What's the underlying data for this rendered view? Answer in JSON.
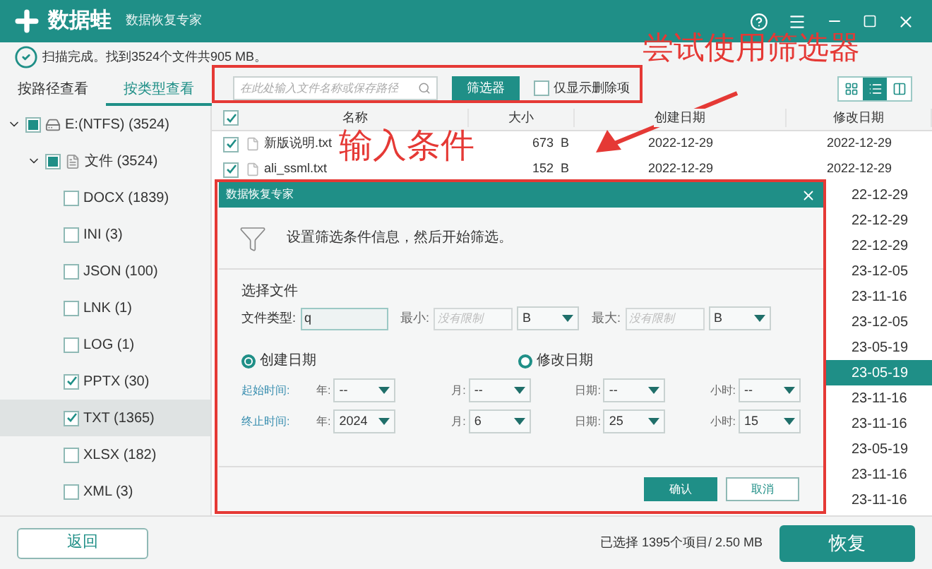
{
  "window": {
    "logo": "数据蛙",
    "subtitle": "数据恢复专家"
  },
  "status": "扫描完成。找到3524个文件共905 MB。",
  "view_tabs": [
    {
      "label": "按路径查看",
      "selected": false
    },
    {
      "label": "按类型查看",
      "selected": true
    }
  ],
  "search": {
    "placeholder": "在此处输入文件名称或保存路径"
  },
  "filter_button": "筛选器",
  "deleted_only": {
    "label": "仅显示删除项",
    "checked": false
  },
  "view_modes": [
    {
      "kind": "grid",
      "selected": false
    },
    {
      "kind": "list",
      "selected": true
    },
    {
      "kind": "columns",
      "selected": false
    }
  ],
  "tree": [
    {
      "label": "E:(NTFS) (3524)",
      "kind": "drive",
      "expanded": true,
      "checked": false,
      "partial": true,
      "children": [
        {
          "label": "文件 (3524)",
          "kind": "folder",
          "expanded": true,
          "checked": false,
          "partial": true,
          "children": [
            {
              "label": "DOCX (1839)",
              "checked": false,
              "selected": false
            },
            {
              "label": "INI (3)",
              "checked": false,
              "selected": false
            },
            {
              "label": "JSON (100)",
              "checked": false,
              "selected": false
            },
            {
              "label": "LNK (1)",
              "checked": false,
              "selected": false
            },
            {
              "label": "LOG (1)",
              "checked": false,
              "selected": false
            },
            {
              "label": "PPTX (30)",
              "checked": true,
              "selected": false
            },
            {
              "label": "TXT (1365)",
              "checked": true,
              "selected": true
            },
            {
              "label": "XLSX (182)",
              "checked": false,
              "selected": false
            },
            {
              "label": "XML (3)",
              "checked": false,
              "selected": false
            }
          ]
        }
      ]
    }
  ],
  "table": {
    "header_checked": true,
    "columns": [
      "名称",
      "大小",
      "创建日期",
      "修改日期"
    ],
    "rows": [
      {
        "checked": true,
        "name": "新版说明.txt",
        "size": "673  B",
        "created": "2022-12-29",
        "modified": "2022-12-29",
        "selected": false
      },
      {
        "checked": true,
        "name": "ali_ssml.txt",
        "size": "152  B",
        "created": "2022-12-29",
        "modified": "2022-12-29",
        "selected": false
      },
      {
        "modified": "22-12-29",
        "selected": false
      },
      {
        "modified": "22-12-29",
        "selected": false
      },
      {
        "modified": "22-12-29",
        "selected": false
      },
      {
        "modified": "23-12-05",
        "selected": false
      },
      {
        "modified": "23-11-16",
        "selected": false
      },
      {
        "modified": "23-12-05",
        "selected": false
      },
      {
        "modified": "23-05-19",
        "selected": false
      },
      {
        "modified": "23-05-19",
        "selected": true
      },
      {
        "modified": "23-11-16",
        "selected": false
      },
      {
        "modified": "23-11-16",
        "selected": false
      },
      {
        "modified": "23-05-19",
        "selected": false
      },
      {
        "modified": "23-11-16",
        "selected": false
      },
      {
        "modified": "23-11-16",
        "selected": false
      }
    ]
  },
  "footer": {
    "back": "返回",
    "selection": "已选择 1395个项目/ 2.50 MB",
    "recover": "恢复"
  },
  "dialog": {
    "title": "数据恢复专家",
    "message": "设置筛选条件信息，然后开始筛选。",
    "section": "选择文件",
    "file_type": {
      "label": "文件类型:",
      "value": "q"
    },
    "min": {
      "label": "最小:",
      "placeholder": "没有限制",
      "unit": "B"
    },
    "max": {
      "label": "最大:",
      "placeholder": "没有限制",
      "unit": "B"
    },
    "date_modes": [
      {
        "label": "创建日期",
        "selected": true
      },
      {
        "label": "修改日期",
        "selected": false
      }
    ],
    "ranges": [
      {
        "label": "起始时间:",
        "fields": [
          {
            "label": "年:",
            "value": "--"
          },
          {
            "label": "月:",
            "value": "--"
          },
          {
            "label": "日期:",
            "value": "--"
          },
          {
            "label": "小时:",
            "value": "--"
          }
        ]
      },
      {
        "label": "终止时间:",
        "fields": [
          {
            "label": "年:",
            "value": "2024"
          },
          {
            "label": "月:",
            "value": "6"
          },
          {
            "label": "日期:",
            "value": "25"
          },
          {
            "label": "小时:",
            "value": "15"
          }
        ]
      }
    ],
    "buttons": [
      {
        "label": "确认",
        "kind": "primary"
      },
      {
        "label": "取消",
        "kind": "secondary"
      }
    ]
  },
  "annotations": [
    {
      "text": "尝试使用筛选器"
    },
    {
      "text": "输入条件"
    }
  ]
}
